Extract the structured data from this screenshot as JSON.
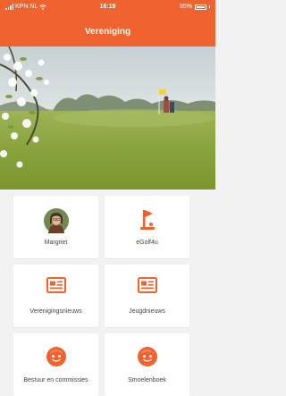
{
  "status_bar": {
    "carrier": "KPN NL",
    "time": "16:19",
    "battery": "95%"
  },
  "header": {
    "title": "Vereniging"
  },
  "tiles": [
    {
      "label": "Margriet",
      "icon": "avatar-photo"
    },
    {
      "label": "eGolf4u",
      "icon": "golf-flag-icon"
    },
    {
      "label": "Verenigingsnieuws",
      "icon": "news-card-icon"
    },
    {
      "label": "Jeugdnieuws",
      "icon": "news-card-icon"
    },
    {
      "label": "Bestuur en commissies",
      "icon": "face-icon"
    },
    {
      "label": "Smoelenboek",
      "icon": "face-icon"
    }
  ],
  "colors": {
    "accent": "#f0622e",
    "background": "#f2f2f2",
    "tile": "#ffffff"
  }
}
